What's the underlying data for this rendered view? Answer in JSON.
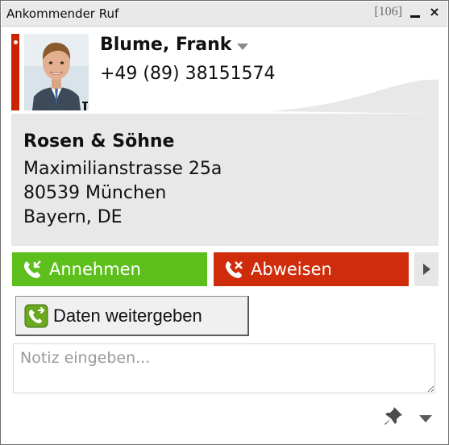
{
  "window": {
    "title": "Ankommender Ruf",
    "counter": "[106]"
  },
  "contact": {
    "name": "Blume, Frank",
    "phone": "+49 (89) 38151574",
    "company": "Rosen & Söhne",
    "address_lines": [
      "Maximilianstrasse 25a",
      "80539 München",
      "Bayern, DE"
    ]
  },
  "actions": {
    "accept_label": "Annehmen",
    "decline_label": "Abweisen",
    "share_label": "Daten weitergeben"
  },
  "note": {
    "placeholder": "Notiz eingeben..."
  },
  "colors": {
    "accept": "#5cbf1c",
    "decline": "#cf2c0c",
    "accent": "#cc2200"
  },
  "icons": {
    "minimize": "minimize-icon",
    "close": "close-icon",
    "contact_menu": "chevron-down-icon",
    "accept": "phone-accept-icon",
    "decline": "phone-decline-icon",
    "more": "chevron-right-icon",
    "share": "share-icon",
    "pin": "pin-icon",
    "options": "chevron-down-icon"
  }
}
